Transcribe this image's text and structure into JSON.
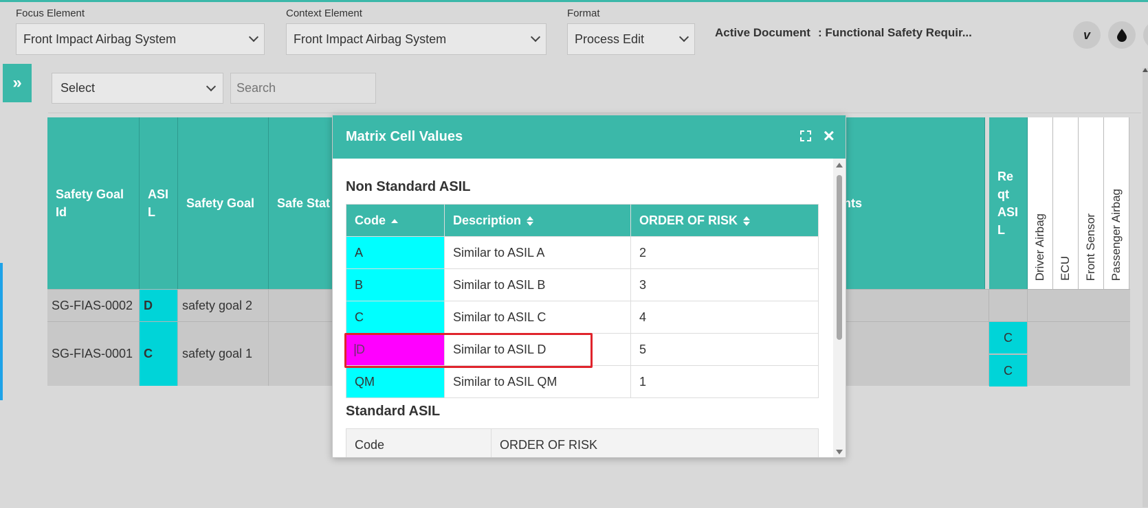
{
  "toolbar": {
    "focus_label": "Focus Element",
    "focus_value": "Front Impact Airbag System",
    "context_label": "Context Element",
    "context_value": "Front Impact Airbag System",
    "format_label": "Format",
    "format_value": "Process Edit",
    "active_doc_label": "Active Document",
    "active_doc_value": ": Functional Safety Requir..."
  },
  "filter": {
    "select_value": "Select",
    "search_placeholder": "Search"
  },
  "matrix": {
    "headers": [
      "Safety Goal Id",
      "ASI L",
      "Safety Goal",
      "Safe Stat",
      "nts",
      "Re qt ASI L"
    ],
    "vertical_headers": [
      "Driver Airbag",
      "ECU",
      "Front Sensor",
      "Passenger Airbag"
    ],
    "rows": [
      {
        "id": "SG-FIAS-0002",
        "asil": "D",
        "goal": "safety goal 2"
      },
      {
        "id": "SG-FIAS-0001",
        "asil": "C",
        "goal": "safety goal 1"
      }
    ],
    "req_asil_values": [
      "C",
      "C"
    ]
  },
  "modal": {
    "title": "Matrix Cell Values",
    "non_standard_title": "Non Standard ASIL",
    "columns": [
      "Code",
      "Description",
      "ORDER OF RISK"
    ],
    "rows": [
      {
        "code": "A",
        "description": "Similar to ASIL A",
        "risk": "2"
      },
      {
        "code": "B",
        "description": "Similar to ASIL B",
        "risk": "3"
      },
      {
        "code": "C",
        "description": "Similar to ASIL C",
        "risk": "4"
      },
      {
        "code": "D",
        "description": "Similar to ASIL D",
        "risk": "5"
      },
      {
        "code": "QM",
        "description": "Similar to ASIL QM",
        "risk": "1"
      }
    ],
    "standard_title": "Standard ASIL",
    "standard_columns": [
      "Code",
      "ORDER OF RISK"
    ]
  },
  "colors": {
    "header_teal": "#3bb8a9",
    "code_cyan": "#00ffff",
    "selected_magenta": "#ff00ff",
    "highlight_red": "#e0242c"
  }
}
